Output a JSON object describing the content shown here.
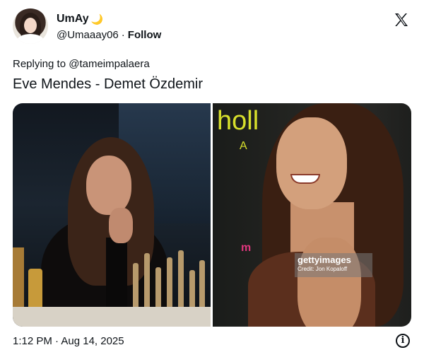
{
  "tweet": {
    "author": {
      "display_name": "UmAy",
      "name_emoji": "🌙",
      "handle": "@Umaaay06",
      "separator": "·",
      "follow_label": "Follow"
    },
    "replying_to": {
      "prefix": "Replying to",
      "mention": "@tameimpalaera"
    },
    "text": "Eve Mendes - Demet Özdemir",
    "media": {
      "left_image_name": "woman-with-makeup-brushes-photo",
      "right_image_name": "smiling-woman-event-photo",
      "right_sign_text": "holl",
      "right_sign_letter": "A",
      "right_pink_text": "m",
      "watermark_brand": "gettyimages",
      "watermark_credit": "Credit: Jon Kopaloff"
    },
    "timestamp": "1:12 PM · Aug 14, 2025",
    "info_icon_glyph": "i"
  },
  "icons": {
    "platform_logo": "x-logo-icon",
    "info": "info-icon"
  },
  "colors": {
    "text": "#0f1419",
    "background": "#ffffff"
  }
}
